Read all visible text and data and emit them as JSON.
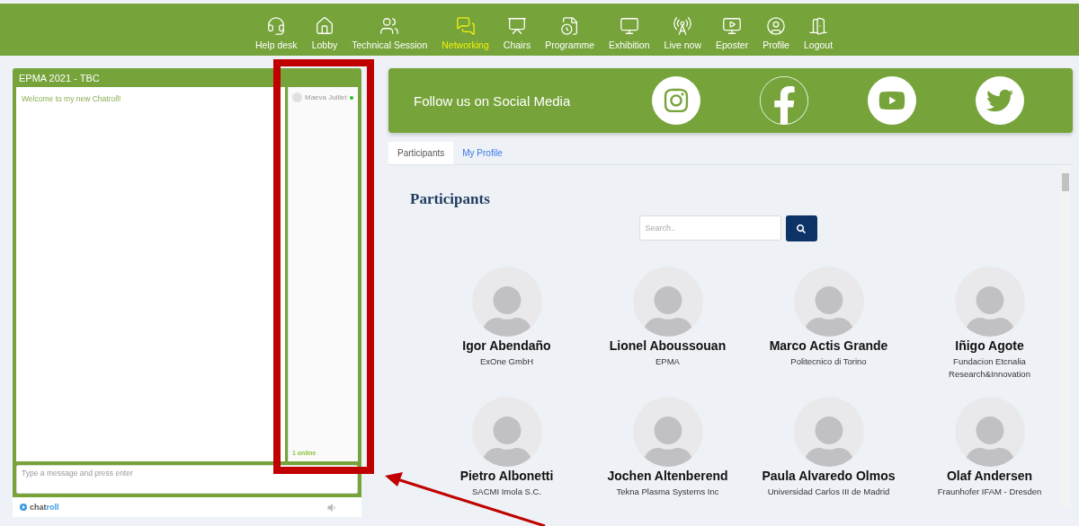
{
  "nav": [
    {
      "label": "Help desk",
      "selected": false
    },
    {
      "label": "Lobby",
      "selected": false
    },
    {
      "label": "Technical Session",
      "selected": false
    },
    {
      "label": "Networking",
      "selected": true
    },
    {
      "label": "Chairs",
      "selected": false
    },
    {
      "label": "Programme",
      "selected": false
    },
    {
      "label": "Exhibition",
      "selected": false
    },
    {
      "label": "Live now",
      "selected": false
    },
    {
      "label": "Eposter",
      "selected": false
    },
    {
      "label": "Profile",
      "selected": false
    },
    {
      "label": "Logout",
      "selected": false
    }
  ],
  "chat": {
    "title": "EPMA 2021 - TBC",
    "messages": [
      "Welcome to my new Chatroll!"
    ],
    "users": [
      {
        "name": "Maeva Juillet",
        "color": "#22c222"
      }
    ],
    "online": "1 online",
    "placeholder": "Type a message and press enter",
    "brand_prefix": "chat",
    "brand_suffix": "roll"
  },
  "social": {
    "title": "Follow us on Social Media"
  },
  "tabs": [
    {
      "label": "Participants",
      "selected": true
    },
    {
      "label": "My Profile",
      "selected": false
    }
  ],
  "participants": {
    "heading": "Participants",
    "search_placeholder": "Search..",
    "people": [
      {
        "name": "Igor Abendaño",
        "org": "ExOne GmbH"
      },
      {
        "name": "Lionel Aboussouan",
        "org": "EPMA"
      },
      {
        "name": "Marco Actis Grande",
        "org": "Politecnico di Torino"
      },
      {
        "name": "Iñigo Agote",
        "org": "Fundacion Etcnalia Research&Innovation"
      },
      {
        "name": "Pietro Albonetti",
        "org": "SACMI Imola S.C."
      },
      {
        "name": "Jochen Altenberend",
        "org": "Tekna Plasma Systems Inc"
      },
      {
        "name": "Paula Alvaredo Olmos",
        "org": "Universidad Carlos III de Madrid"
      },
      {
        "name": "Olaf Andersen",
        "org": "Fraunhofer IFAM - Dresden"
      }
    ]
  }
}
